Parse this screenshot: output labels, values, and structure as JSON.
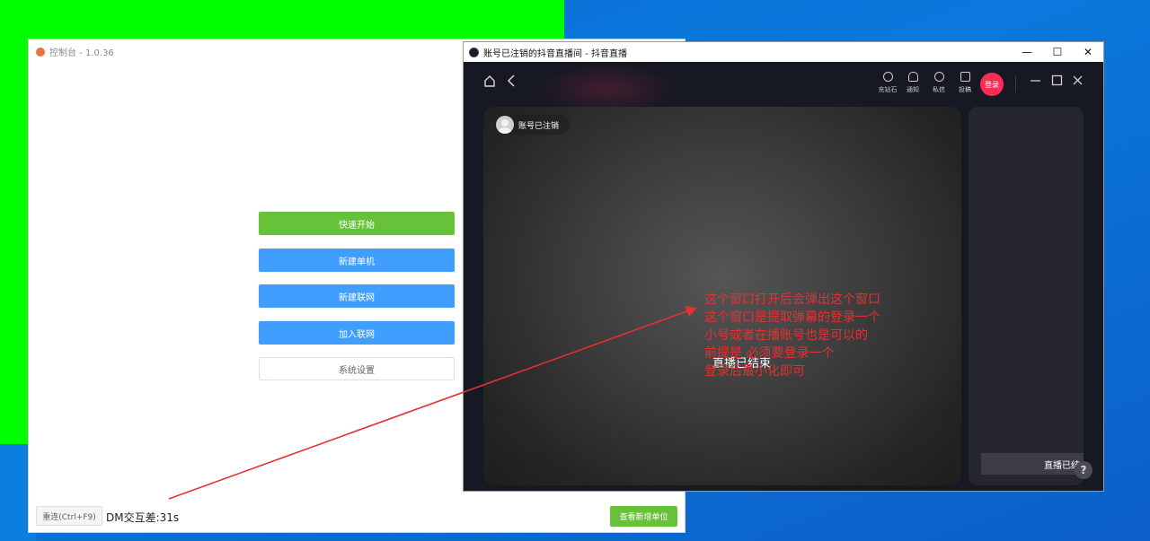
{
  "console": {
    "title": "控制台 - 1.0.36",
    "buttons": {
      "quick_start": "快速开始",
      "new_single": "新建单机",
      "new_network": "新建联网",
      "join_network": "加入联网",
      "settings": "系统设置"
    },
    "footer": {
      "reconnect": "重连(Ctrl+F9)",
      "dm_status": "DM交互差:31s",
      "view_new": "查看新增单位"
    }
  },
  "live_window": {
    "title": "账号已注销的抖音直播间 - 抖音直播",
    "window_controls": {
      "minimize": "—",
      "maximize": "☐",
      "close": "✕"
    },
    "topbar": {
      "recharge": "充钻石",
      "notify": "通知",
      "message": "私信",
      "submit": "投稿",
      "login": "登录"
    },
    "anchor_name": "账号已注销",
    "ended_text": "直播已结束",
    "side_ended_text": "直播已结",
    "help": "?"
  },
  "annotation": {
    "lines": [
      "这个窗口打开后会弹出这个窗口",
      "这个窗口是提取弹幕的登录一个",
      "小号或者在播账号也是可以的",
      "前提是 必须要登录一个",
      "登录后最小化即可"
    ],
    "color": "#e53030"
  },
  "colors": {
    "green_button": "#67c23a",
    "blue_button": "#409eff",
    "login_red": "#fe2c55",
    "live_bg": "#161823"
  }
}
